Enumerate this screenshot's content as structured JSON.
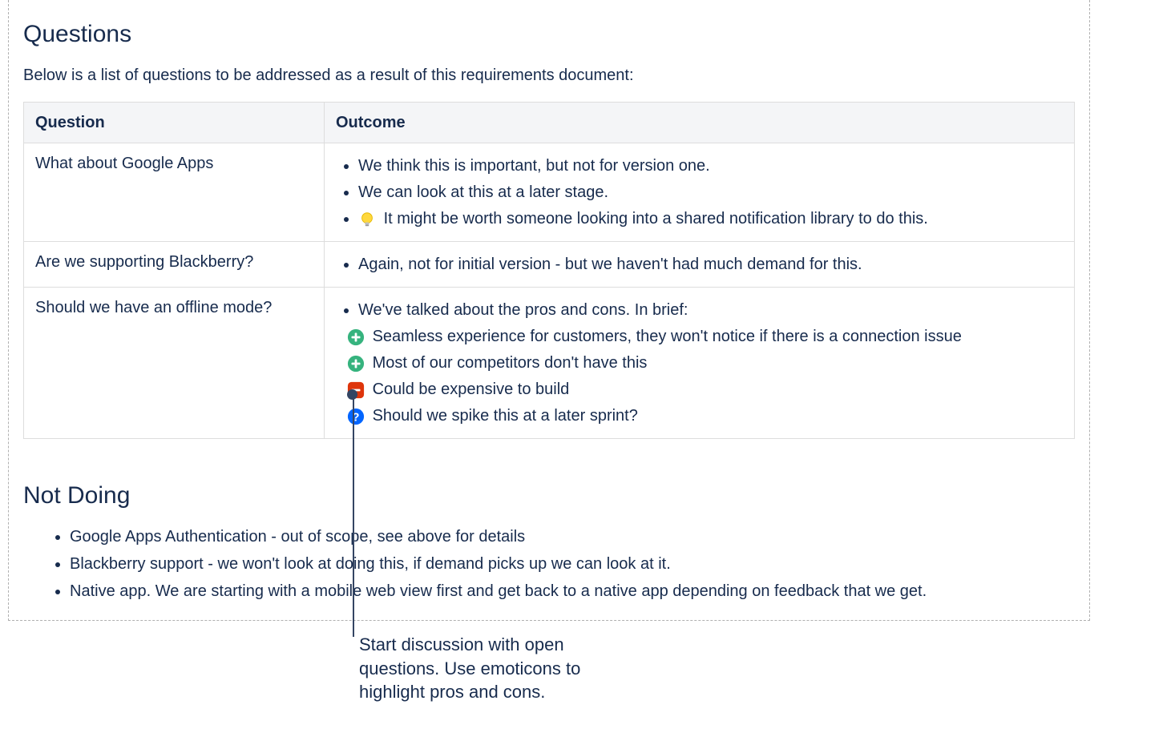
{
  "sections": {
    "questions": {
      "heading": "Questions",
      "intro": "Below is a list of questions to be addressed as a result of this requirements document:",
      "columns": [
        "Question",
        "Outcome"
      ],
      "rows": [
        {
          "question": "What about Google Apps",
          "items": [
            {
              "icon": null,
              "text": "We think this is important, but not for version one."
            },
            {
              "icon": null,
              "text": "We can look at this at a later stage."
            },
            {
              "icon": "lightbulb",
              "text": "It might be worth someone looking into a shared notification library to do this."
            }
          ]
        },
        {
          "question": "Are we supporting Blackberry?",
          "items": [
            {
              "icon": null,
              "text": "Again, not for initial version - but we haven't had much demand for this."
            }
          ]
        },
        {
          "question": "Should we have an offline mode?",
          "items": [
            {
              "icon": null,
              "text": "We've talked about the pros and cons. In brief:"
            },
            {
              "icon": "plus",
              "text": "Seamless experience for customers, they won't notice if there is a connection issue"
            },
            {
              "icon": "plus",
              "text": "Most of our competitors don't have this"
            },
            {
              "icon": "minus",
              "text": "Could be expensive to build"
            },
            {
              "icon": "question",
              "text": "Should we spike this at a later sprint?"
            }
          ]
        }
      ]
    },
    "not_doing": {
      "heading": "Not Doing",
      "items": [
        "Google Apps Authentication - out of scope, see above for details",
        "Blackberry support - we won't look at doing this, if demand picks up we can look at it.",
        "Native app. We are starting with a mobile web view first and get back to a native app depending on feedback that we get."
      ]
    }
  },
  "callout": "Start discussion with open questions. Use emoticons to highlight pros and cons."
}
